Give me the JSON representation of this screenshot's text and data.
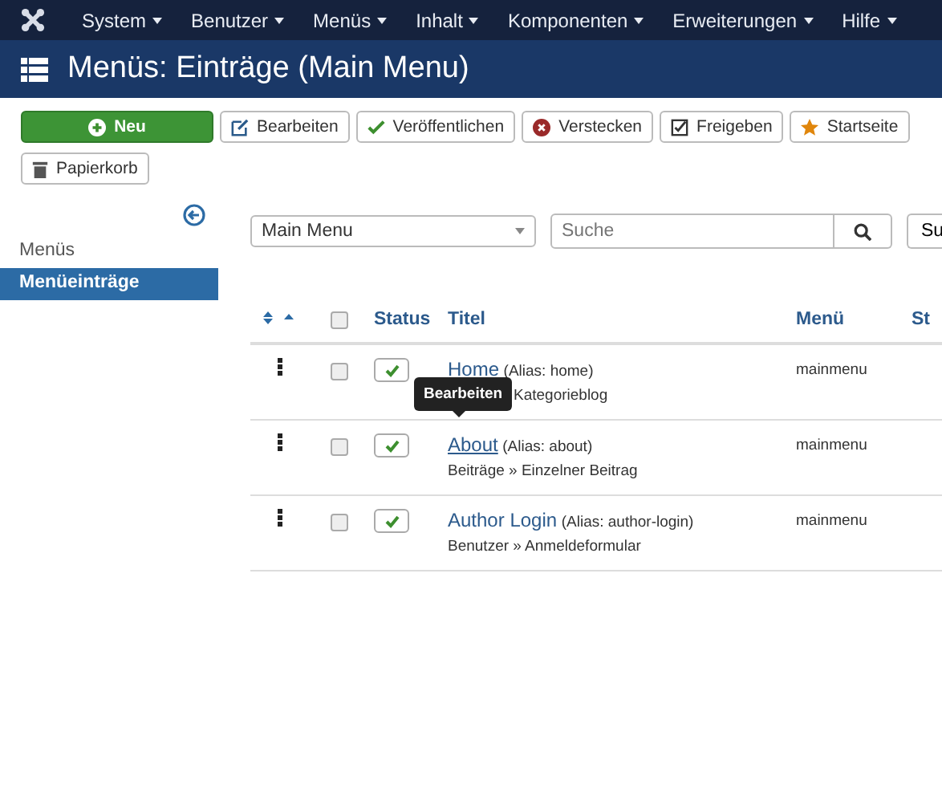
{
  "menubar": {
    "items": [
      "System",
      "Benutzer",
      "Menüs",
      "Inhalt",
      "Komponenten",
      "Erweiterungen",
      "Hilfe"
    ]
  },
  "header": {
    "title": "Menüs: Einträge (Main Menu)"
  },
  "toolbar": [
    {
      "label": "Neu",
      "kind": "new"
    },
    {
      "label": "Bearbeiten",
      "kind": "edit"
    },
    {
      "label": "Veröffentlichen",
      "kind": "publish"
    },
    {
      "label": "Verstecken",
      "kind": "unpublish"
    },
    {
      "label": "Freigeben",
      "kind": "checkin"
    },
    {
      "label": "Startseite",
      "kind": "home"
    },
    {
      "label": "Papierkorb",
      "kind": "trash"
    }
  ],
  "sidebar": {
    "items": [
      {
        "label": "Menüs",
        "selected": false
      },
      {
        "label": "Menüeinträge",
        "selected": true
      }
    ]
  },
  "filters": {
    "menu_select": "Main Menu",
    "search": {
      "placeholder": "Suche"
    },
    "cut_button": "Su"
  },
  "table": {
    "select_all_checked": false,
    "columns": [
      "Status",
      "Titel",
      "Menü",
      "St"
    ],
    "rows": [
      {
        "title": "Home",
        "alias": "(Alias: home)",
        "subtitle": "Kategorieblog",
        "menu": "mainmenu",
        "published": true,
        "checked": false
      },
      {
        "title": "About",
        "alias": "(Alias: about)",
        "subtitle": "Beiträge » Einzelner Beitrag",
        "menu": "mainmenu",
        "published": true,
        "checked": false
      },
      {
        "title": "Author Login",
        "alias": "(Alias: author-login)",
        "subtitle": "Benutzer » Anmeldeformular",
        "menu": "mainmenu",
        "published": true,
        "checked": false
      }
    ]
  },
  "tooltip": "Bearbeiten"
}
